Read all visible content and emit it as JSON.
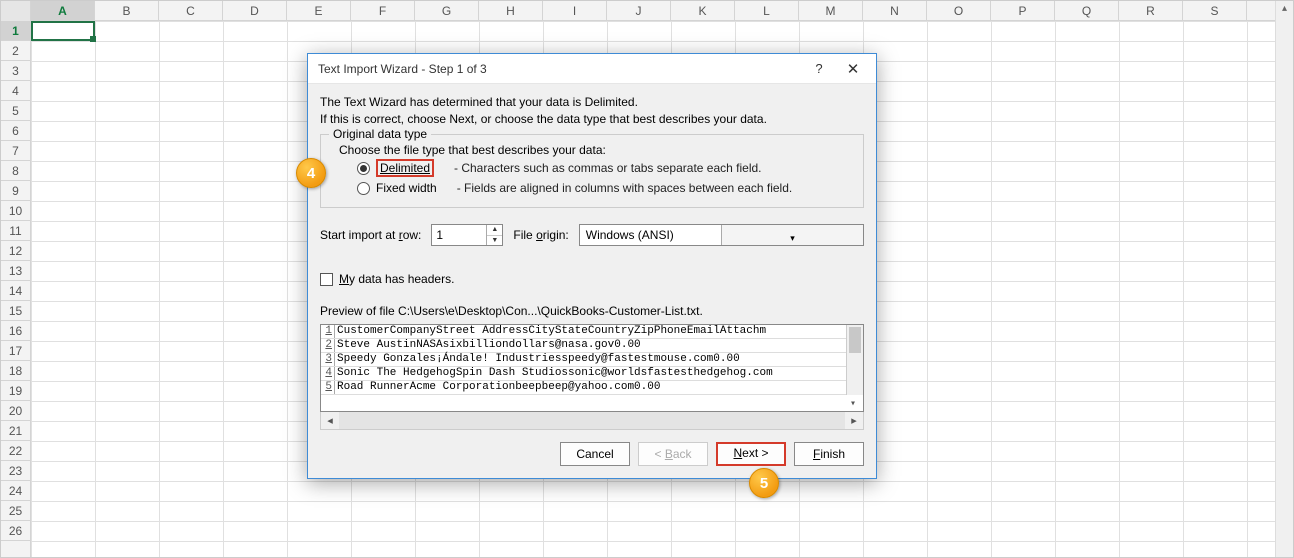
{
  "columns": [
    "A",
    "B",
    "C",
    "D",
    "E",
    "F",
    "G",
    "H",
    "I",
    "J",
    "K",
    "L",
    "M",
    "N",
    "O",
    "P",
    "Q",
    "R",
    "S"
  ],
  "rows_count": 26,
  "active_col": "A",
  "active_row": 1,
  "callouts": {
    "c4": "4",
    "c5": "5"
  },
  "dialog": {
    "title": "Text Import Wizard - Step 1 of 3",
    "help_symbol": "?",
    "close_symbol": "✕",
    "intro1": "The Text Wizard has determined that your data is Delimited.",
    "intro2": "If this is correct, choose Next, or choose the data type that best describes your data.",
    "group_legend": "Original data type",
    "group_hint": "Choose the file type that best describes your data:",
    "radio_delimited_label": "Delimited",
    "radio_delimited_desc": "- Characters such as commas or tabs separate each field.",
    "radio_fixed_label": "Fixed width",
    "radio_fixed_desc": "- Fields are aligned in columns with spaces between each field.",
    "start_row_label": "Start import at row:",
    "start_row_value": "1",
    "file_origin_label": "File origin:",
    "file_origin_value": "Windows (ANSI)",
    "headers_checkbox": "My data has headers.",
    "preview_label": "Preview of file C:\\Users\\e\\Desktop\\Con...\\QuickBooks-Customer-List.txt.",
    "preview_lines": [
      {
        "n": "1",
        "t": "CustomerCompanyStreet AddressCityStateCountryZipPhoneEmailAttachm"
      },
      {
        "n": "2",
        "t": "Steve AustinNASAsixbilliondollars@nasa.gov0.00"
      },
      {
        "n": "3",
        "t": "Speedy Gonzales¡Ándale! Industriesspeedy@fastestmouse.com0.00"
      },
      {
        "n": "4",
        "t": "Sonic The HedgehogSpin Dash Studiossonic@worldsfastesthedgehog.com"
      },
      {
        "n": "5",
        "t": "Road RunnerAcme Corporationbeepbeep@yahoo.com0.00"
      }
    ],
    "buttons": {
      "cancel": "Cancel",
      "back": "< Back",
      "next": "Next >",
      "finish": "Finish"
    }
  }
}
